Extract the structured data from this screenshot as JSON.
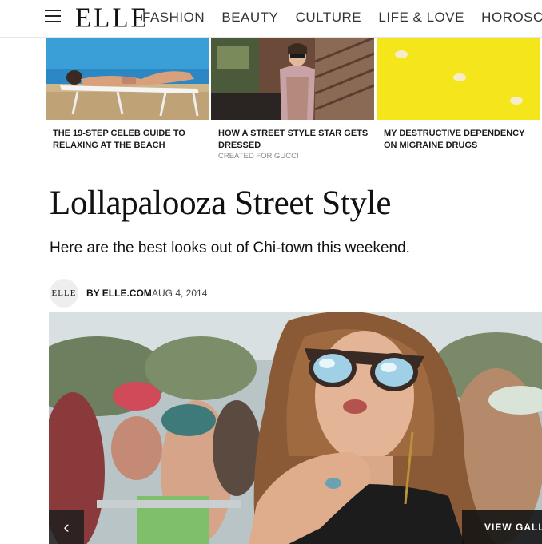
{
  "header": {
    "logo": "ELLE",
    "nav": [
      "FASHION",
      "BEAUTY",
      "CULTURE",
      "LIFE & LOVE",
      "HOROSCOPES"
    ]
  },
  "cards": [
    {
      "title": "THE 19-STEP CELEB GUIDE TO RELAXING AT THE BEACH",
      "sponsor": ""
    },
    {
      "title": "HOW A STREET STYLE STAR GETS DRESSED",
      "sponsor": "CREATED FOR GUCCI"
    },
    {
      "title": "MY DESTRUCTIVE DEPENDENCY ON MIGRAINE DRUGS",
      "sponsor": ""
    }
  ],
  "article": {
    "headline": "Lollapalooza Street Style",
    "dek": "Here are the best looks out of Chi-town this weekend.",
    "avatar_text": "ELLE",
    "author": "BY ELLE.COM",
    "date": "AUG 4, 2014"
  },
  "hero": {
    "prev_icon": "‹",
    "gallery_label": "VIEW GALLERY"
  },
  "colors": {
    "pill_yellow": "#f5e51b",
    "text_dark": "#111111"
  }
}
